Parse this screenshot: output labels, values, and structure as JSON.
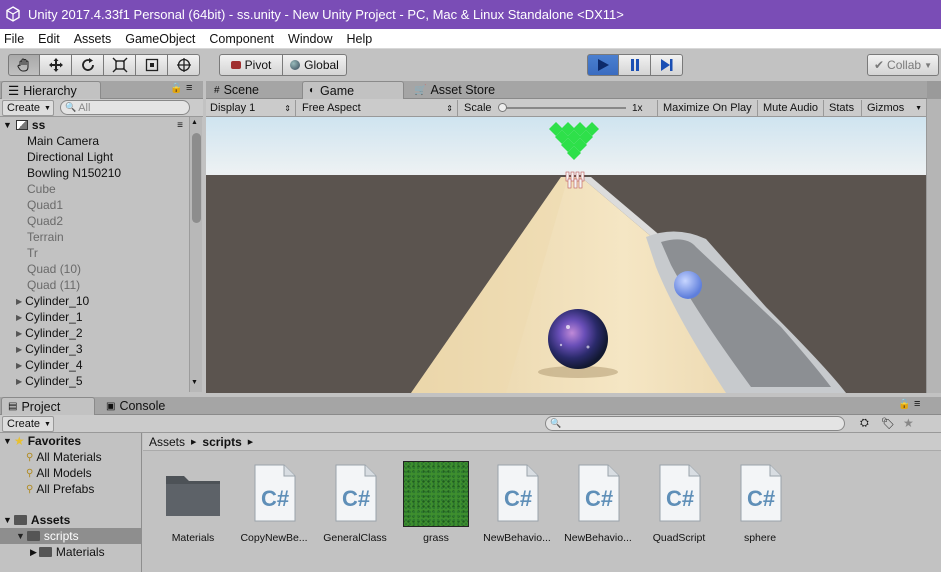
{
  "window": {
    "title": "Unity 2017.4.33f1 Personal (64bit) - ss.unity - New Unity Project - PC, Mac & Linux Standalone <DX11>"
  },
  "menu": [
    "File",
    "Edit",
    "Assets",
    "GameObject",
    "Component",
    "Window",
    "Help"
  ],
  "toolbar": {
    "tools": [
      "hand-icon",
      "move-icon",
      "rotate-icon",
      "scale-icon",
      "rect-icon",
      "transform-icon"
    ],
    "pivot": "Pivot",
    "global": "Global",
    "collab": "Collab"
  },
  "hierarchy": {
    "tab": "Hierarchy",
    "create": "Create",
    "search_placeholder": "All",
    "scene": "ss",
    "items": [
      {
        "label": "Main Camera",
        "active": true,
        "arrow": false
      },
      {
        "label": "Directional Light",
        "active": true,
        "arrow": false
      },
      {
        "label": "Bowling N150210",
        "active": true,
        "arrow": false
      },
      {
        "label": "Cube",
        "active": false,
        "arrow": false
      },
      {
        "label": "Quad1",
        "active": false,
        "arrow": false
      },
      {
        "label": "Quad2",
        "active": false,
        "arrow": false
      },
      {
        "label": "Terrain",
        "active": false,
        "arrow": false
      },
      {
        "label": "Tr",
        "active": false,
        "arrow": false
      },
      {
        "label": "Quad (10)",
        "active": false,
        "arrow": false
      },
      {
        "label": "Quad (11)",
        "active": false,
        "arrow": false
      },
      {
        "label": "Cylinder_10",
        "active": true,
        "arrow": true
      },
      {
        "label": "Cylinder_1",
        "active": true,
        "arrow": true
      },
      {
        "label": "Cylinder_2",
        "active": true,
        "arrow": true
      },
      {
        "label": "Cylinder_3",
        "active": true,
        "arrow": true
      },
      {
        "label": "Cylinder_4",
        "active": true,
        "arrow": true
      },
      {
        "label": "Cylinder_5",
        "active": true,
        "arrow": true
      }
    ]
  },
  "game_view": {
    "tabs": [
      "Scene",
      "Game",
      "Asset Store"
    ],
    "display": "Display 1",
    "aspect": "Free Aspect",
    "scale_label": "Scale",
    "scale_value": "1x",
    "maximize": "Maximize On Play",
    "mute": "Mute Audio",
    "stats": "Stats",
    "gizmos": "Gizmos"
  },
  "project": {
    "tabs": [
      "Project",
      "Console"
    ],
    "create": "Create",
    "favorites": {
      "label": "Favorites",
      "items": [
        "All Materials",
        "All Models",
        "All Prefabs"
      ]
    },
    "assets_root": "Assets",
    "tree": [
      "scripts",
      "Materials"
    ],
    "breadcrumb": [
      "Assets",
      "scripts"
    ],
    "assets": [
      {
        "label": "Materials",
        "type": "folder"
      },
      {
        "label": "CopyNewBe...",
        "type": "script"
      },
      {
        "label": "GeneralClass",
        "type": "script"
      },
      {
        "label": "grass",
        "type": "texture"
      },
      {
        "label": "NewBehavio...",
        "type": "script"
      },
      {
        "label": "NewBehavio...",
        "type": "script"
      },
      {
        "label": "QuadScript",
        "type": "script"
      },
      {
        "label": "sphere",
        "type": "script"
      }
    ]
  },
  "colors": {
    "title_bg": "#7a4db6",
    "play_blue": "#3a6cc0",
    "pins_green": "#2ee04a"
  }
}
